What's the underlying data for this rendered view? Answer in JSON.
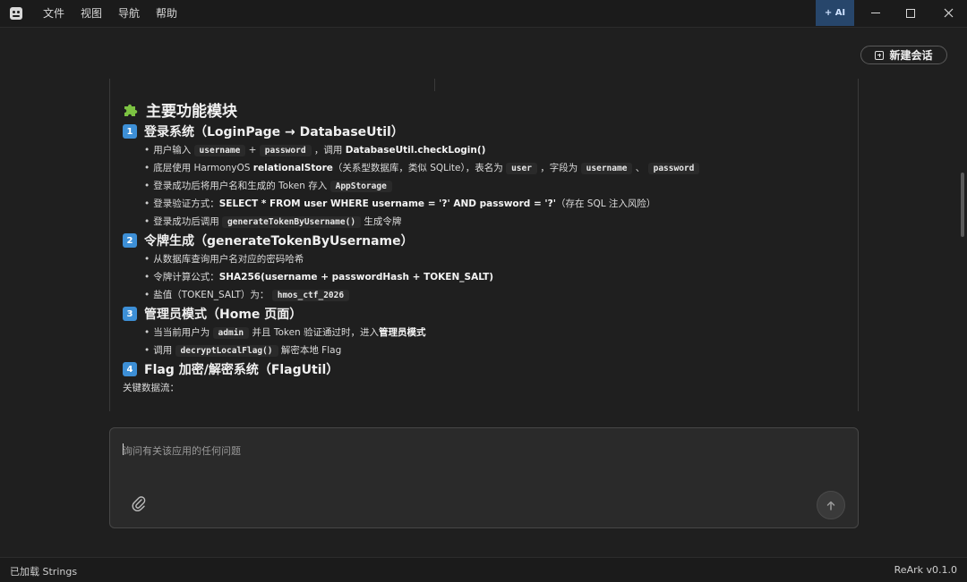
{
  "menu": {
    "items": [
      "文件",
      "视图",
      "导航",
      "帮助"
    ]
  },
  "titlebar": {
    "ai_label": "+ AI"
  },
  "toolbar": {
    "new_chat_label": "新建会话"
  },
  "chat": {
    "section_title": "主要功能模块",
    "modules": [
      {
        "num": "1",
        "title": "登录系统（LoginPage → DatabaseUtil）",
        "b1": {
          "t1": "用户输入 ",
          "c1": "username",
          "t2": " + ",
          "c2": "password",
          "t3": " ，调用 ",
          "s1": "DatabaseUtil.checkLogin()"
        },
        "b2": {
          "t1": "底层使用 HarmonyOS ",
          "s1": "relationalStore",
          "t2": "（关系型数据库，类似 SQLite），表名为 ",
          "c1": "user",
          "t3": " ，字段为 ",
          "c2": "username",
          "t4": " 、 ",
          "c3": "password"
        },
        "b3": {
          "t1": "登录成功后将用户名和生成的 Token 存入 ",
          "c1": "AppStorage"
        },
        "b4": {
          "t1": "登录验证方式：",
          "s1": "SELECT * FROM user WHERE username = '?' AND password = '?'",
          "t2": "（存在 SQL 注入风险）"
        },
        "b5": {
          "t1": "登录成功后调用 ",
          "c1": "generateTokenByUsername()",
          "t2": " 生成令牌"
        }
      },
      {
        "num": "2",
        "title": "令牌生成（generateTokenByUsername）",
        "b1": {
          "t1": "从数据库查询用户名对应的密码哈希"
        },
        "b2": {
          "t1": "令牌计算公式：",
          "s1": "SHA256(username + passwordHash + TOKEN_SALT)"
        },
        "b3": {
          "t1": "盐值（TOKEN_SALT）为： ",
          "c1": "hmos_ctf_2026"
        }
      },
      {
        "num": "3",
        "title": "管理员模式（Home 页面）",
        "b1": {
          "t1": "当当前用户为 ",
          "c1": "admin",
          "t2": " 并且 Token 验证通过时，进入",
          "s1": "管理员模式"
        },
        "b2": {
          "t1": "调用 ",
          "c1": "decryptLocalFlag()",
          "t2": " 解密本地 Flag"
        }
      },
      {
        "num": "4",
        "title": "Flag 加密/解密系统（FlagUtil）"
      }
    ],
    "trailing_text": "关键数据流："
  },
  "input": {
    "placeholder": "询问有关该应用的任何问题"
  },
  "status": {
    "left": "已加载 Strings",
    "right": "ReArk v0.1.0"
  }
}
